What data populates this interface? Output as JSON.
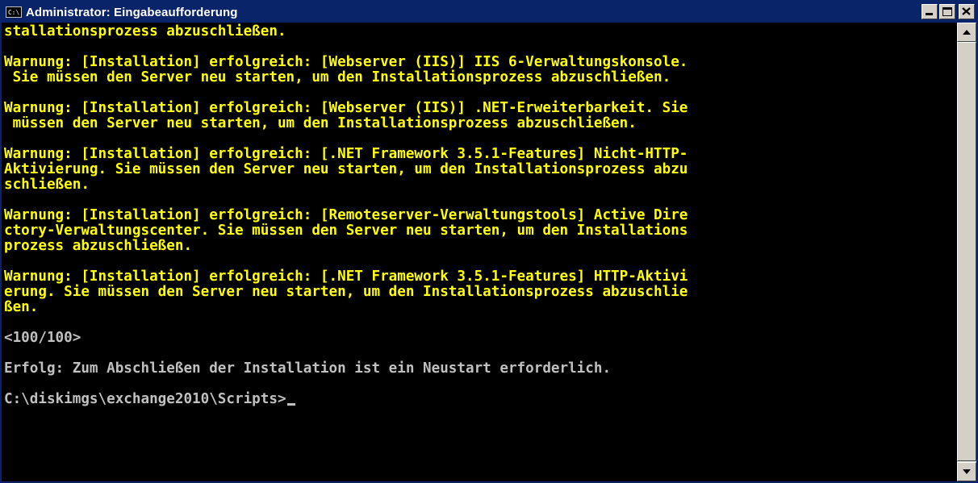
{
  "window": {
    "title": "Administrator: Eingabeaufforderung",
    "icon_label": "C:\\",
    "buttons": [
      "minimize-icon",
      "maximize-icon",
      "close-icon"
    ]
  },
  "console": {
    "colors": {
      "background": "#000000",
      "warning_text": "#ffff00",
      "normal_text": "#c0c0c0"
    },
    "lines": [
      "stallationsprozess abzuschließen.",
      "",
      "Warnung: [Installation] erfolgreich: [Webserver (IIS)] IIS 6-Verwaltungskonsole.",
      " Sie müssen den Server neu starten, um den Installationsprozess abzuschließen.",
      "",
      "Warnung: [Installation] erfolgreich: [Webserver (IIS)] .NET-Erweiterbarkeit. Sie",
      " müssen den Server neu starten, um den Installationsprozess abzuschließen.",
      "",
      "Warnung: [Installation] erfolgreich: [.NET Framework 3.5.1-Features] Nicht-HTTP-",
      "Aktivierung. Sie müssen den Server neu starten, um den Installationsprozess abzu",
      "schließen.",
      "",
      "Warnung: [Installation] erfolgreich: [Remoteserver-Verwaltungstools] Active Dire",
      "ctory-Verwaltungscenter. Sie müssen den Server neu starten, um den Installations",
      "prozess abzuschließen.",
      "",
      "Warnung: [Installation] erfolgreich: [.NET Framework 3.5.1-Features] HTTP-Aktivi",
      "erung. Sie müssen den Server neu starten, um den Installationsprozess abzuschlie",
      "ßen.",
      "",
      "<100/100>",
      "",
      "Erfolg: Zum Abschließen der Installation ist ein Neustart erforderlich.",
      "",
      "C:\\diskimgs\\exchange2010\\Scripts>"
    ]
  }
}
